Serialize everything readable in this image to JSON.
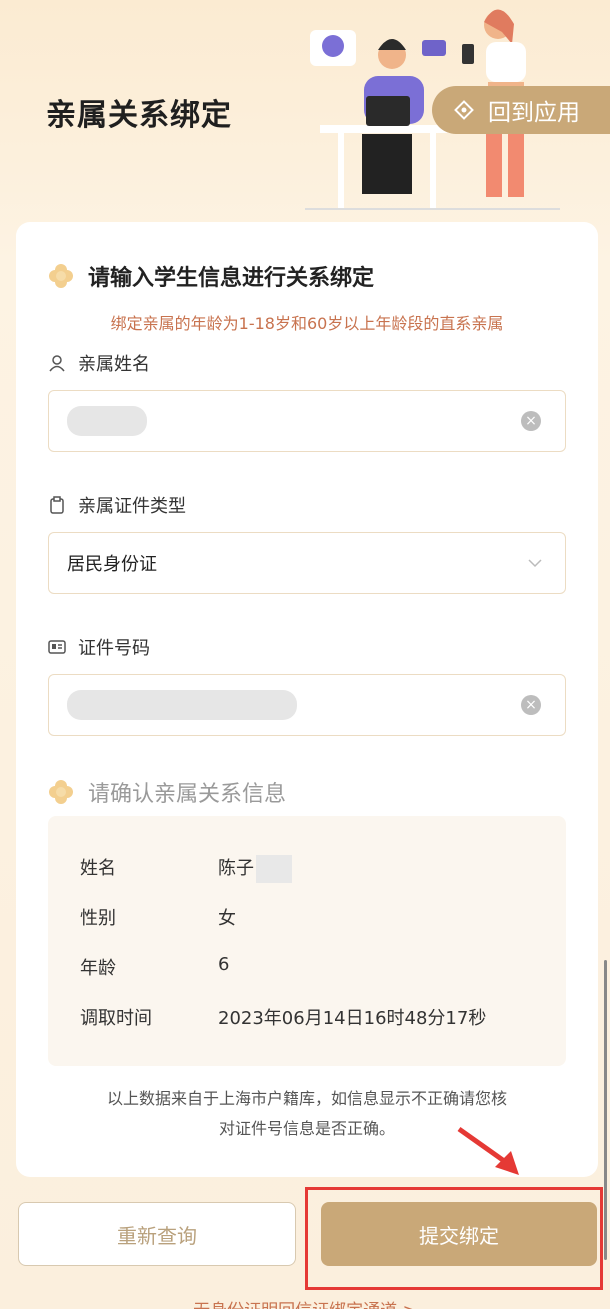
{
  "header": {
    "title": "亲属关系绑定",
    "back_label": "回到应用"
  },
  "section1": {
    "title": "请输入学生信息进行关系绑定",
    "notice": "绑定亲属的年龄为1-18岁和60岁以上年龄段的直系亲属"
  },
  "fields": {
    "name_label": "亲属姓名",
    "id_type_label": "亲属证件类型",
    "id_type_value": "居民身份证",
    "id_number_label": "证件号码"
  },
  "section2": {
    "title": "请确认亲属关系信息"
  },
  "info": {
    "rows": [
      {
        "key": "姓名",
        "value": "陈子"
      },
      {
        "key": "性别",
        "value": "女"
      },
      {
        "key": "年龄",
        "value": "6"
      },
      {
        "key": "调取时间",
        "value": "2023年06月14日16时48分17秒"
      }
    ]
  },
  "footnote": {
    "line1": "以上数据来自于上海市户籍库，如信息显示不正确请您核",
    "line2": "对证件号信息是否正确。"
  },
  "buttons": {
    "requery": "重新查询",
    "submit": "提交绑定"
  },
  "bottom_link": "无身份证明回信证绑定通道 >",
  "colors": {
    "accent": "#c9a878",
    "notice": "#c8734f",
    "highlight": "#e53935"
  }
}
